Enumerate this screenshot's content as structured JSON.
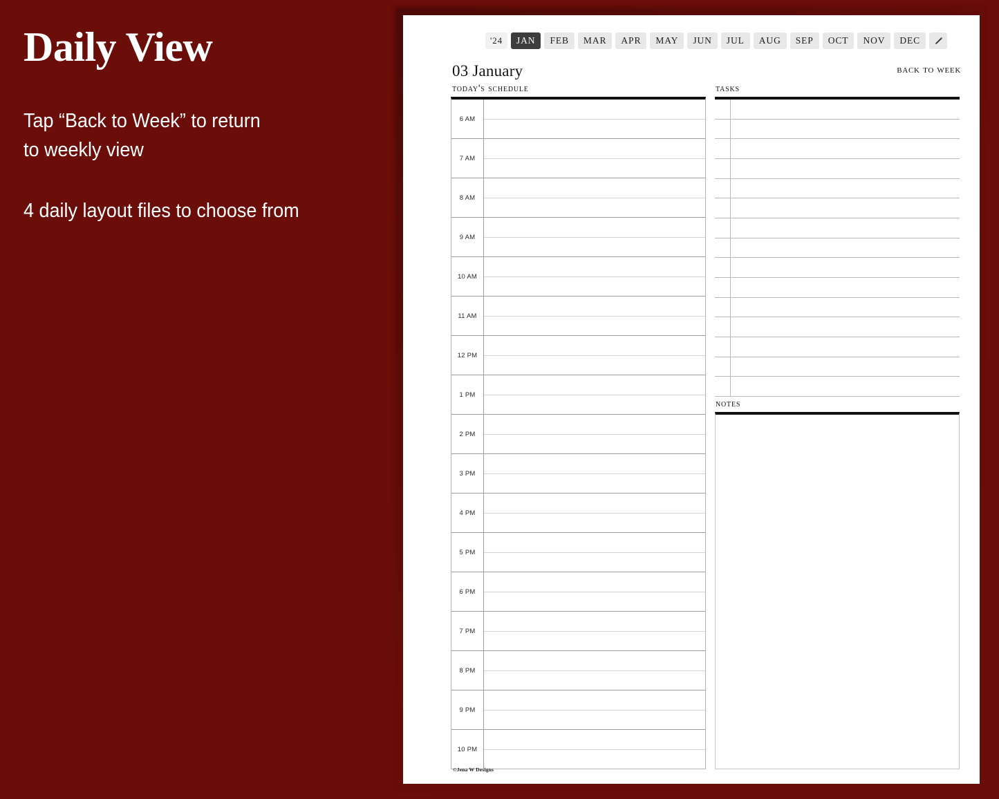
{
  "promo": {
    "title": "Daily View",
    "line1": "Tap “Back to Week” to return",
    "line2": "to weekly view",
    "line3": "4 daily layout files to choose from",
    "background_color": "#6b0d09",
    "text_color": "#ffffff"
  },
  "planner": {
    "month_tabs": [
      {
        "label": "'24",
        "name": "year",
        "active": false
      },
      {
        "label": "JAN",
        "name": "january",
        "active": true
      },
      {
        "label": "FEB",
        "name": "february",
        "active": false
      },
      {
        "label": "MAR",
        "name": "march",
        "active": false
      },
      {
        "label": "APR",
        "name": "april",
        "active": false
      },
      {
        "label": "MAY",
        "name": "may",
        "active": false
      },
      {
        "label": "JUN",
        "name": "june",
        "active": false
      },
      {
        "label": "JUL",
        "name": "july",
        "active": false
      },
      {
        "label": "AUG",
        "name": "august",
        "active": false
      },
      {
        "label": "SEP",
        "name": "september",
        "active": false
      },
      {
        "label": "OCT",
        "name": "october",
        "active": false
      },
      {
        "label": "NOV",
        "name": "november",
        "active": false
      },
      {
        "label": "DEC",
        "name": "december",
        "active": false
      }
    ],
    "pen_tool_icon": "pencil-icon",
    "date_heading": "03 January",
    "back_to_week": "Back To Week",
    "schedule_label": "Today's Schedule",
    "tasks_label": "Tasks",
    "notes_label": "Notes",
    "hours": [
      "6 AM",
      "7 AM",
      "8 AM",
      "9 AM",
      "10 AM",
      "11 AM",
      "12 PM",
      "1 PM",
      "2 PM",
      "3 PM",
      "4 PM",
      "5 PM",
      "6 PM",
      "7 PM",
      "8 PM",
      "9 PM",
      "10 PM"
    ],
    "task_row_count": 15,
    "footer": "©Jena W Designs",
    "accent_active_tab_color": "#3d3d3d",
    "tab_color": "#e8e8e8",
    "rule_color": "#111111"
  }
}
